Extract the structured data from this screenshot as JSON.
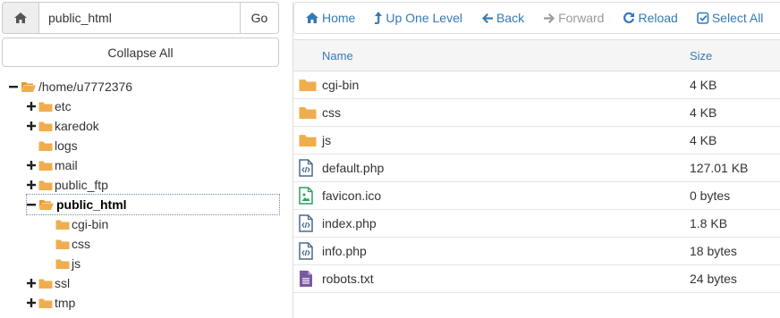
{
  "path_bar": {
    "home_icon": "home-icon",
    "path_value": "public_html",
    "go_label": "Go"
  },
  "collapse_all_label": "Collapse All",
  "tree": {
    "root": {
      "label": "/home/u7772376",
      "expanded": true
    },
    "items": [
      {
        "label": "etc",
        "has_children": true
      },
      {
        "label": "karedok",
        "has_children": true
      },
      {
        "label": "logs",
        "has_children": false
      },
      {
        "label": "mail",
        "has_children": true
      },
      {
        "label": "public_ftp",
        "has_children": true
      },
      {
        "label": "public_html",
        "has_children": true,
        "expanded": true,
        "selected": true,
        "children": [
          {
            "label": "cgi-bin"
          },
          {
            "label": "css"
          },
          {
            "label": "js"
          }
        ]
      },
      {
        "label": "ssl",
        "has_children": true
      },
      {
        "label": "tmp",
        "has_children": true
      }
    ]
  },
  "toolbar": {
    "home_label": "Home",
    "up_label": "Up One Level",
    "back_label": "Back",
    "forward_label": "Forward",
    "reload_label": "Reload",
    "select_all_label": "Select All"
  },
  "table": {
    "headers": {
      "name": "Name",
      "size": "Size"
    },
    "rows": [
      {
        "icon": "folder",
        "name": "cgi-bin",
        "size": "4 KB"
      },
      {
        "icon": "folder",
        "name": "css",
        "size": "4 KB"
      },
      {
        "icon": "folder",
        "name": "js",
        "size": "4 KB"
      },
      {
        "icon": "code-file",
        "name": "default.php",
        "size": "127.01 KB"
      },
      {
        "icon": "image-file",
        "name": "favicon.ico",
        "size": "0 bytes"
      },
      {
        "icon": "code-file",
        "name": "index.php",
        "size": "1.8 KB"
      },
      {
        "icon": "code-file",
        "name": "info.php",
        "size": "18 bytes"
      },
      {
        "icon": "text-file",
        "name": "robots.txt",
        "size": "24 bytes"
      }
    ]
  },
  "colors": {
    "link": "#337ab7",
    "folder": "#f0ad4e",
    "code_file": "#4a6a8a",
    "image_file": "#2e9e5b",
    "text_file": "#7a5a9e",
    "disabled": "#999999"
  }
}
